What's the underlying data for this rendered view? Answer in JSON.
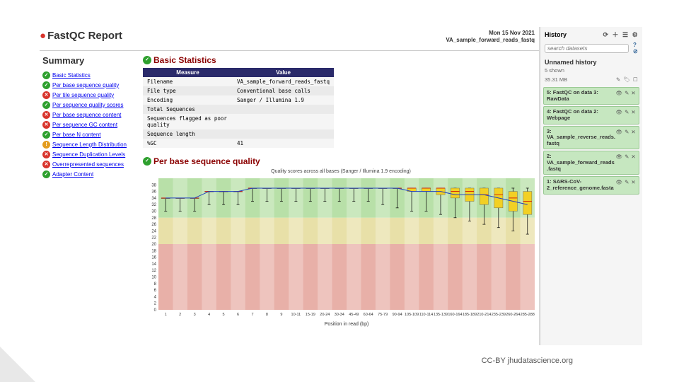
{
  "report": {
    "title_text": "FastQC Report",
    "date_line1": "Mon 15 Nov 2021",
    "date_line2": "VA_sample_forward_reads_fastq"
  },
  "sidebar": {
    "title": "Summary",
    "items": [
      {
        "status": "pass",
        "label": "Basic Statistics"
      },
      {
        "status": "pass",
        "label": "Per base sequence quality"
      },
      {
        "status": "fail",
        "label": "Per tile sequence quality"
      },
      {
        "status": "pass",
        "label": "Per sequence quality scores"
      },
      {
        "status": "fail",
        "label": "Per base sequence content"
      },
      {
        "status": "fail",
        "label": "Per sequence GC content"
      },
      {
        "status": "pass",
        "label": "Per base N content"
      },
      {
        "status": "warn",
        "label": "Sequence Length Distribution"
      },
      {
        "status": "fail",
        "label": "Sequence Duplication Levels"
      },
      {
        "status": "fail",
        "label": "Overrepresented sequences"
      },
      {
        "status": "pass",
        "label": "Adapter Content"
      }
    ]
  },
  "basic_stats": {
    "section_title": "Basic Statistics",
    "header_measure": "Measure",
    "header_value": "Value",
    "rows": [
      {
        "measure": "Filename",
        "value": "VA_sample_forward_reads_fastq"
      },
      {
        "measure": "File type",
        "value": "Conventional base calls"
      },
      {
        "measure": "Encoding",
        "value": "Sanger / Illumina 1.9"
      },
      {
        "measure": "Total Sequences",
        "value": ""
      },
      {
        "measure": "Sequences flagged as poor quality",
        "value": ""
      },
      {
        "measure": "Sequence length",
        "value": ""
      },
      {
        "measure": "%GC",
        "value": "41"
      }
    ]
  },
  "quality_section": {
    "title": "Per base sequence quality",
    "chart_caption": "Quality scores across all bases (Sanger / Illumina 1.9 encoding)",
    "xaxis_label": "Position in read (bp)"
  },
  "chart_data": {
    "type": "boxplot",
    "title": "Quality scores across all bases (Sanger / Illumina 1.9 encoding)",
    "xlabel": "Position in read (bp)",
    "ylabel": "",
    "ylim": [
      0,
      40
    ],
    "y_ticks": [
      0,
      2,
      4,
      6,
      8,
      10,
      12,
      14,
      16,
      18,
      20,
      22,
      24,
      26,
      28,
      30,
      32,
      34,
      36,
      38
    ],
    "zones": {
      "green_above": 28,
      "yellow_above": 20
    },
    "categories": [
      "1",
      "2",
      "3",
      "4",
      "5",
      "6",
      "7",
      "8",
      "9",
      "10-11",
      "15-19",
      "20-24",
      "30-34",
      "45-49",
      "60-64",
      "75-79",
      "90-94",
      "105-109",
      "110-114",
      "135-139",
      "160-164",
      "185-189",
      "210-214",
      "235-239",
      "260-264",
      "285-288"
    ],
    "series": [
      {
        "name": "mean",
        "values": [
          34,
          34,
          34,
          36,
          36,
          36,
          37,
          37,
          37,
          37,
          37,
          37,
          37,
          37,
          37,
          37,
          37,
          36,
          36,
          36,
          35,
          35,
          35,
          34,
          33,
          32
        ]
      }
    ],
    "boxes": [
      {
        "pos": "1",
        "lw": 30,
        "q1": 34,
        "med": 34,
        "q3": 34,
        "uw": 34
      },
      {
        "pos": "2",
        "lw": 30,
        "q1": 34,
        "med": 34,
        "q3": 34,
        "uw": 34
      },
      {
        "pos": "3",
        "lw": 30,
        "q1": 34,
        "med": 34,
        "q3": 34,
        "uw": 34
      },
      {
        "pos": "4",
        "lw": 32,
        "q1": 36,
        "med": 36,
        "q3": 36,
        "uw": 36
      },
      {
        "pos": "5",
        "lw": 32,
        "q1": 36,
        "med": 36,
        "q3": 36,
        "uw": 36
      },
      {
        "pos": "6",
        "lw": 32,
        "q1": 36,
        "med": 36,
        "q3": 36,
        "uw": 36
      },
      {
        "pos": "7",
        "lw": 33,
        "q1": 37,
        "med": 37,
        "q3": 37,
        "uw": 37
      },
      {
        "pos": "8",
        "lw": 33,
        "q1": 37,
        "med": 37,
        "q3": 37,
        "uw": 37
      },
      {
        "pos": "9",
        "lw": 33,
        "q1": 37,
        "med": 37,
        "q3": 37,
        "uw": 37
      },
      {
        "pos": "10-11",
        "lw": 33,
        "q1": 37,
        "med": 37,
        "q3": 37,
        "uw": 37
      },
      {
        "pos": "15-19",
        "lw": 33,
        "q1": 37,
        "med": 37,
        "q3": 37,
        "uw": 37
      },
      {
        "pos": "20-24",
        "lw": 33,
        "q1": 37,
        "med": 37,
        "q3": 37,
        "uw": 37
      },
      {
        "pos": "30-34",
        "lw": 33,
        "q1": 37,
        "med": 37,
        "q3": 37,
        "uw": 37
      },
      {
        "pos": "45-49",
        "lw": 33,
        "q1": 37,
        "med": 37,
        "q3": 37,
        "uw": 37
      },
      {
        "pos": "60-64",
        "lw": 33,
        "q1": 37,
        "med": 37,
        "q3": 37,
        "uw": 37
      },
      {
        "pos": "75-79",
        "lw": 32,
        "q1": 37,
        "med": 37,
        "q3": 37,
        "uw": 37
      },
      {
        "pos": "90-94",
        "lw": 31,
        "q1": 37,
        "med": 37,
        "q3": 37,
        "uw": 37
      },
      {
        "pos": "105-109",
        "lw": 30,
        "q1": 36,
        "med": 37,
        "q3": 37,
        "uw": 37
      },
      {
        "pos": "110-114",
        "lw": 30,
        "q1": 36,
        "med": 37,
        "q3": 37,
        "uw": 37
      },
      {
        "pos": "135-139",
        "lw": 29,
        "q1": 35,
        "med": 37,
        "q3": 37,
        "uw": 37
      },
      {
        "pos": "160-164",
        "lw": 28,
        "q1": 34,
        "med": 36,
        "q3": 37,
        "uw": 37
      },
      {
        "pos": "185-189",
        "lw": 27,
        "q1": 33,
        "med": 36,
        "q3": 37,
        "uw": 37
      },
      {
        "pos": "210-214",
        "lw": 26,
        "q1": 32,
        "med": 35,
        "q3": 37,
        "uw": 37
      },
      {
        "pos": "235-239",
        "lw": 25,
        "q1": 31,
        "med": 35,
        "q3": 37,
        "uw": 37
      },
      {
        "pos": "260-264",
        "lw": 24,
        "q1": 30,
        "med": 34,
        "q3": 36,
        "uw": 37
      },
      {
        "pos": "285-288",
        "lw": 23,
        "q1": 29,
        "med": 33,
        "q3": 36,
        "uw": 37
      }
    ]
  },
  "history": {
    "title": "History",
    "search_placeholder": "search datasets",
    "name": "Unnamed history",
    "shown": "5 shown",
    "size": "35.31 MB",
    "items": [
      {
        "label": "5: FastQC on data 3: RawData"
      },
      {
        "label": "4: FastQC on data 2: Webpage"
      },
      {
        "label": "3: VA_sample_reverse_reads.fastq"
      },
      {
        "label": "2: VA_sample_forward_reads.fastq"
      },
      {
        "label": "1: SARS-CoV-2_reference_genome.fasta"
      }
    ]
  },
  "attribution": "CC-BY  jhudatascience.org"
}
